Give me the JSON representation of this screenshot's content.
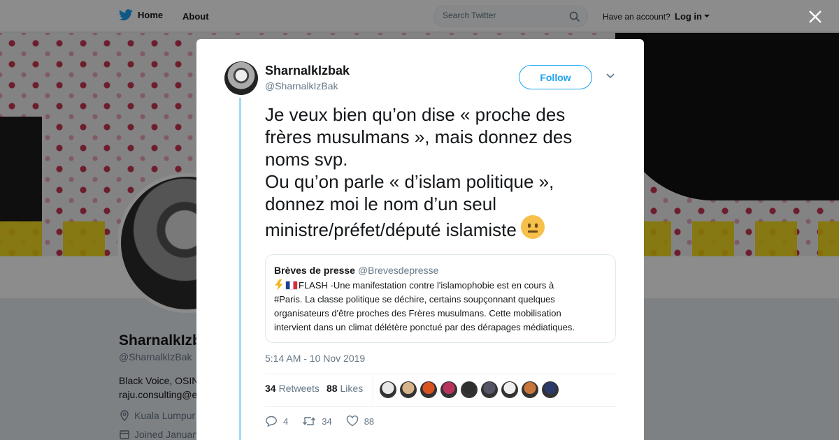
{
  "topbar": {
    "home_label": "Home",
    "about_label": "About",
    "search_placeholder": "Search Twitter",
    "account_prompt": "Have an account?",
    "login_label": "Log in"
  },
  "profile": {
    "name": "SharnalkIzbak",
    "handle": "@SharnalkIzBak",
    "bio_line1": "Black Voice, OSIN",
    "bio_line2": "raju.consulting@e",
    "location": "Kuala Lumpur",
    "joined": "Joined January"
  },
  "tweet": {
    "author_name": "SharnalkIzbak",
    "author_handle": "@SharnalkIzBak",
    "follow_label": "Follow",
    "text_lines": [
      "Je veux bien qu’on dise « proche des",
      "frères musulmans », mais donnez des",
      "noms svp.",
      "Ou qu’on parle « d’islam politique »,",
      "donnez moi le nom d’un seul",
      "ministre/préfet/député islamiste"
    ],
    "timestamp": "5:14 AM - 10 Nov 2019",
    "retweets_count": "34",
    "retweets_label": "Retweets",
    "likes_count": "88",
    "likes_label": "Likes",
    "reply_count": "4",
    "retweet_action_count": "34",
    "like_action_count": "88"
  },
  "quoted": {
    "name": "Brèves de presse",
    "handle": "@Brevesdepresse",
    "text_lines": [
      "FLASH -Une manifestation contre l'islamophobie est en cours à",
      "#Paris. La classe politique se déchire, certains soupçonnant quelques",
      "organisateurs d'être proches des Frères musulmans. Cette mobilisation",
      "intervient dans un climat délétère ponctué par des dérapages médiatiques."
    ]
  },
  "icons": {
    "brand": "twitter-bird-icon",
    "search": "search-icon",
    "close": "close-icon",
    "caret": "caret-down-icon",
    "chevron": "chevron-down-icon",
    "reply": "reply-icon",
    "retweet": "retweet-icon",
    "like": "heart-icon",
    "location": "location-pin-icon",
    "calendar": "calendar-icon",
    "emoji": "neutral-face-emoji",
    "bolt": "high-voltage-emoji",
    "flag": "france-flag-emoji"
  },
  "colors": {
    "accent": "#1da1f2",
    "text": "#14171a",
    "secondary": "#657786",
    "thread_line": "#a6d8f6"
  },
  "liker_avatar_colors": [
    "#e8e8e8",
    "#d8b48a",
    "#d8531f",
    "#b8345d",
    "#2f2f2f",
    "#555566",
    "#f0f0f0",
    "#c8763a",
    "#2a3a6a"
  ]
}
